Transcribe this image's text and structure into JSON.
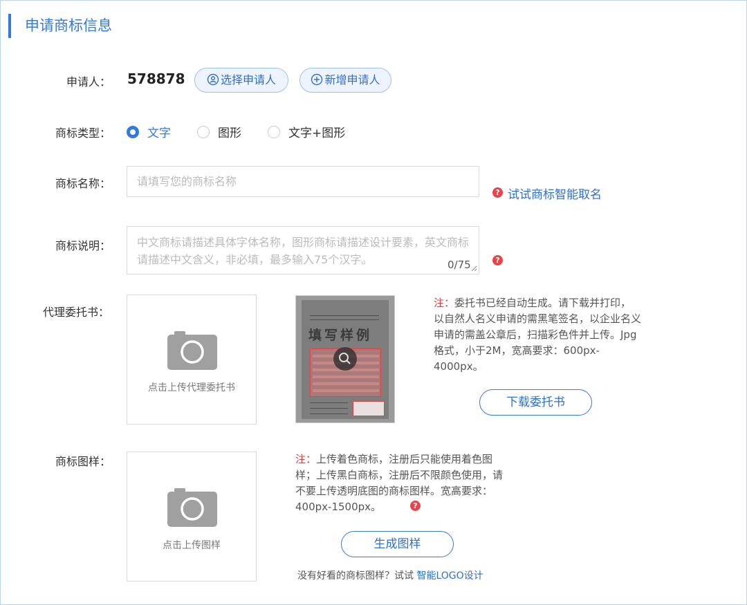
{
  "section_title": "申请商标信息",
  "applicant": {
    "label": "申请人：",
    "name": "578878",
    "select_button": "选择申请人",
    "add_button": "新增申请人"
  },
  "trademark_type": {
    "label": "商标类型：",
    "options": [
      {
        "label": "文字",
        "checked": true
      },
      {
        "label": "图形",
        "checked": false
      },
      {
        "label": "文字+图形",
        "checked": false
      }
    ]
  },
  "trademark_name": {
    "label": "商标名称：",
    "placeholder": "请填写您的商标名称",
    "value": "",
    "smart_naming_link": "试试商标智能取名"
  },
  "trademark_description": {
    "label": "商标说明：",
    "placeholder": "中文商标请描述具体字体名称，图形商标请描述设计要素，英文商标请描述中文含义，非必填，最多输入75个汉字。",
    "value": "",
    "counter": "0/75"
  },
  "power_of_attorney": {
    "label": "代理委托书：",
    "upload_text": "点击上传代理委托书",
    "sample_watermark": "填写样例",
    "note_label": "注：",
    "note_text": "委托书已经自动生成。请下载并打印，以自然人名义申请的需黑笔签名，以企业名义申请的需盖公章后，扫描彩色件并上传。Jpg格式，小于2M，宽高要求：600px-4000px。",
    "download_button": "下载委托书"
  },
  "trademark_image": {
    "label": "商标图样：",
    "upload_text": "点击上传图样",
    "note_label": "注：",
    "note_text": "上传着色商标，注册后只能使用着色图样；上传黑白商标，注册后不限颜色使用，请不要上传透明底图的商标图样。宽高要求：400px-1500px。",
    "generate_button": "生成图样",
    "footer_text": "没有好看的商标图样？试试 ",
    "footer_link": "智能LOGO设计"
  },
  "colors": {
    "accent": "#2f7ae5",
    "warning": "#e9444a",
    "note_label": "#e23a3a"
  },
  "icons": {
    "help": "question-circle-icon",
    "camera": "camera-icon",
    "user": "user-circle-icon",
    "plus": "plus-circle-icon",
    "magnifier": "magnifier-icon"
  }
}
